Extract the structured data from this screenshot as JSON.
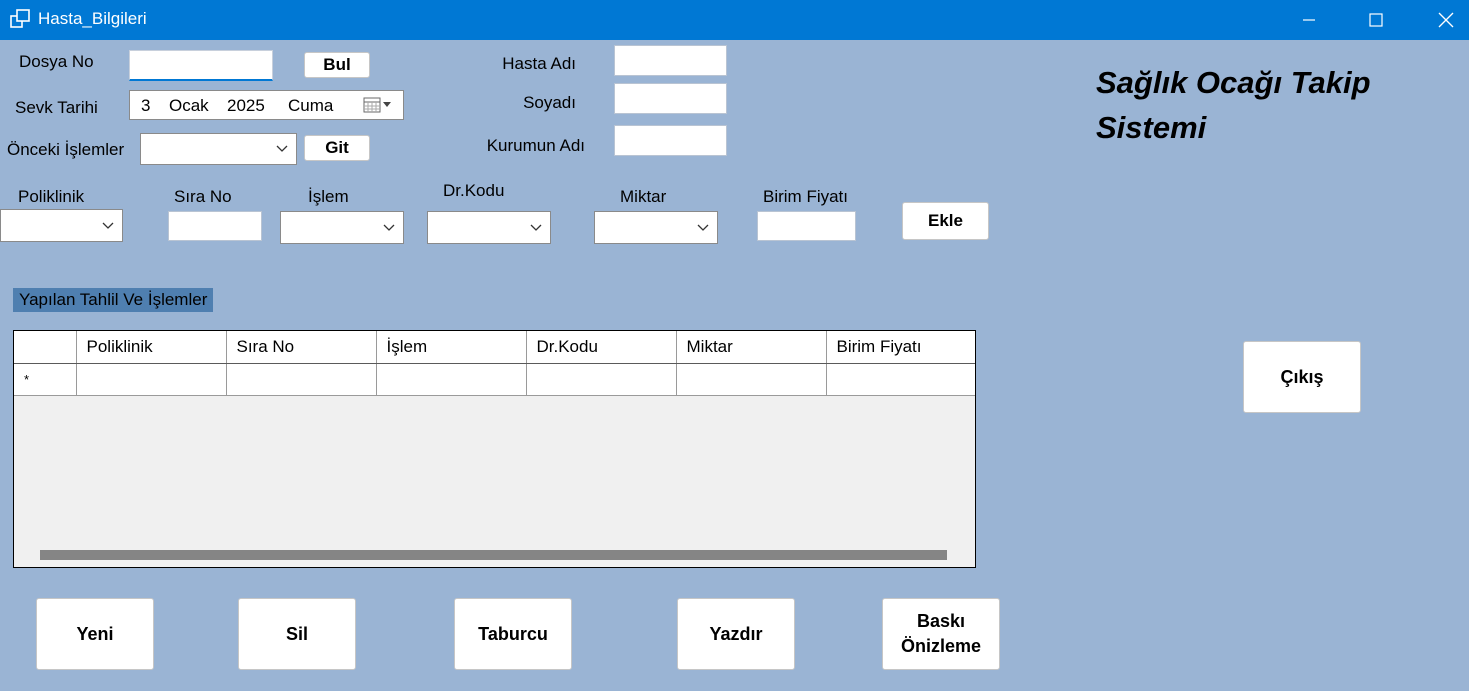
{
  "window": {
    "title": "Hasta_Bilgileri"
  },
  "form": {
    "dosya_no_label": "Dosya No",
    "dosya_no_value": "",
    "bul_button": "Bul",
    "sevk_tarihi_label": "Sevk Tarihi",
    "date": {
      "day": "3",
      "month": "Ocak",
      "year": "2025",
      "weekday": "Cuma"
    },
    "onceki_islemler_label": "Önceki İşlemler",
    "onceki_islemler_value": "",
    "git_button": "Git",
    "hasta_adi_label": "Hasta Adı",
    "soyadi_label": "Soyadı",
    "kurumun_adi_label": "Kurumun Adı",
    "hasta_adi_value": "",
    "soyadi_value": "",
    "kurumun_adi_value": ""
  },
  "app_title": {
    "line1": "Sağlık Ocağı Takip",
    "line2": "Sistemi"
  },
  "entry": {
    "poliklinik_label": "Poliklinik",
    "sira_no_label": "Sıra No",
    "islem_label": "İşlem",
    "dr_kodu_label": "Dr.Kodu",
    "miktar_label": "Miktar",
    "birim_fiyati_label": "Birim Fiyatı",
    "ekle_button": "Ekle"
  },
  "section": {
    "label": "Yapılan Tahlil Ve İşlemler"
  },
  "grid": {
    "columns": [
      "",
      "Poliklinik",
      "Sıra No",
      "İşlem",
      "Dr.Kodu",
      "Miktar",
      "Birim Fiyatı"
    ],
    "new_row_marker": "*"
  },
  "buttons": {
    "cikis": "Çıkış",
    "yeni": "Yeni",
    "sil": "Sil",
    "taburcu": "Taburcu",
    "yazdir": "Yazdır",
    "baski_line1": "Baskı",
    "baski_line2": "Önizleme"
  },
  "colors": {
    "titlebar": "#0078d4",
    "background": "#9ab4d4",
    "section_label": "#4f7fb0"
  }
}
